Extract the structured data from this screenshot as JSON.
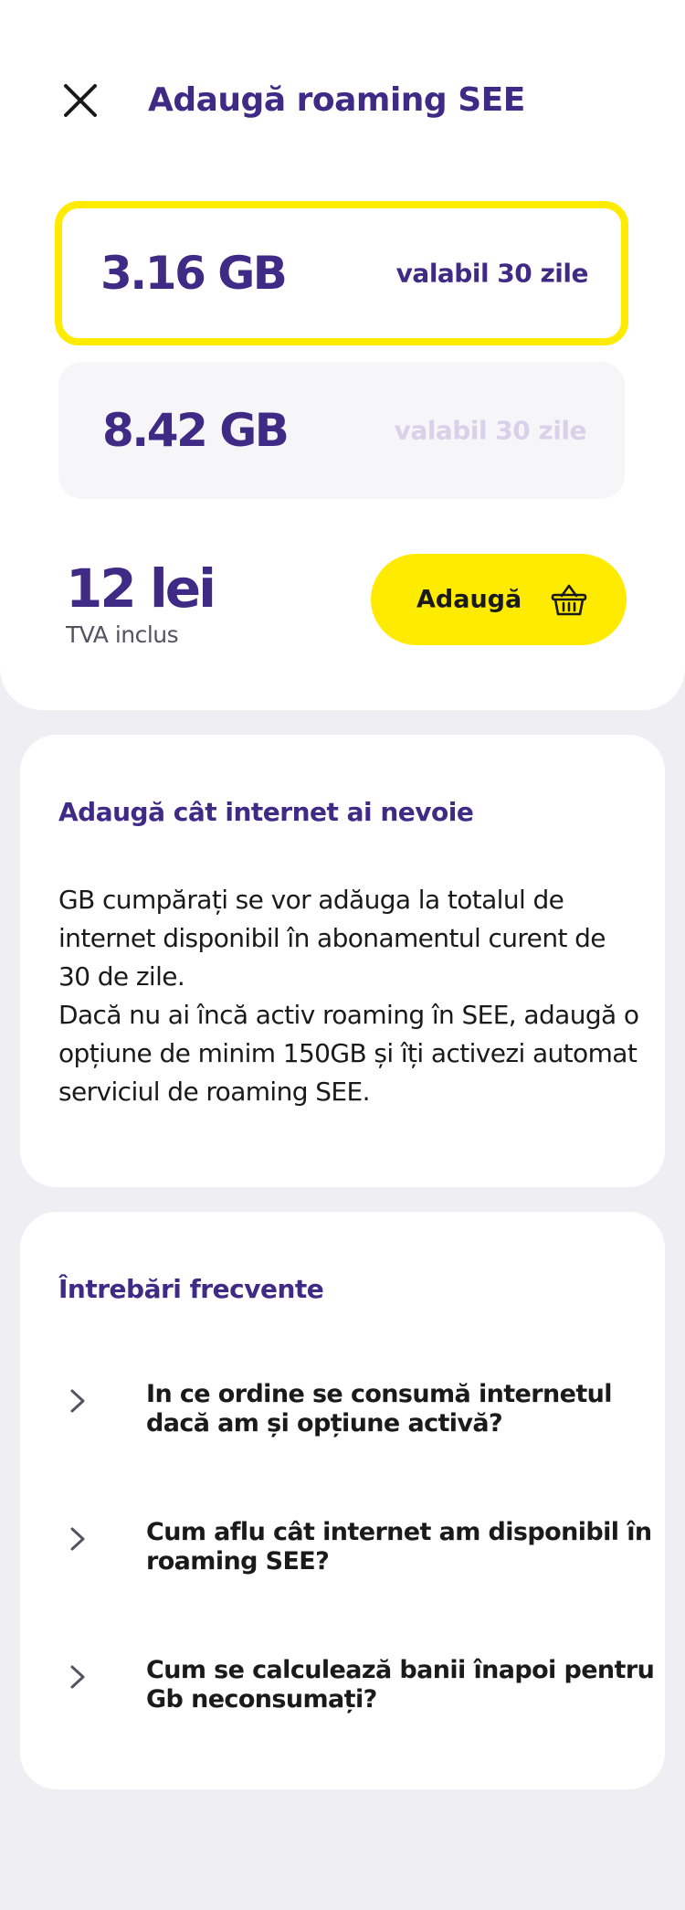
{
  "header": {
    "title": "Adaugă roaming SEE",
    "close_icon": "close-icon"
  },
  "options": [
    {
      "size": "3.16 GB",
      "validity": "valabil 30 zile",
      "selected": true
    },
    {
      "size": "8.42 GB",
      "validity": "valabil 30 zile",
      "selected": false
    }
  ],
  "purchase": {
    "price": "12 lei",
    "vat": "TVA inclus",
    "add_label": "Adaugă",
    "basket_icon": "basket-icon"
  },
  "info": {
    "title": "Adaugă cât internet ai nevoie",
    "paragraph_1": "GB cumpărați se vor adăuga la totalul de internet disponibil în abonamentul curent de 30 de zile.",
    "paragraph_2": "Dacă nu ai încă activ roaming în SEE, adaugă o opțiune de minim 150GB și îți activezi automat serviciul de roaming SEE."
  },
  "faq": {
    "title": "Întrebări frecvente",
    "items": [
      {
        "question": "In ce ordine se consumă internetul dacă am și opțiune activă?"
      },
      {
        "question": "Cum aflu cât internet am disponibil în roaming SEE?"
      },
      {
        "question": "Cum se calculează banii înapoi pentru Gb neconsumați?"
      }
    ]
  },
  "colors": {
    "brand_purple": "#3f2a86",
    "brand_yellow": "#ffeb00",
    "background": "#efeef3"
  }
}
